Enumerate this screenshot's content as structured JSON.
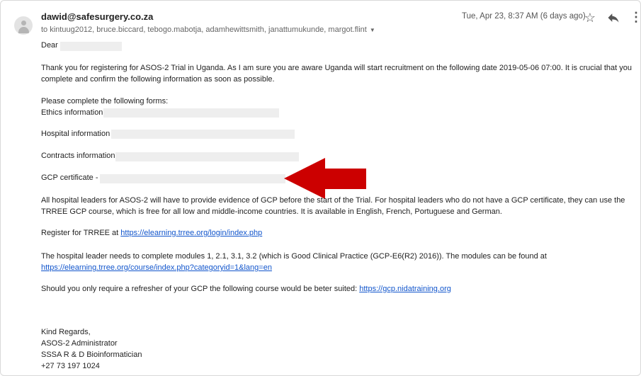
{
  "header": {
    "sender": "dawid@safesurgery.co.za",
    "recipients": "to kintuug2012, bruce.biccard, tebogo.mabotja, adamhewittsmith, janattumukunde, margot.flint",
    "date": "Tue, Apr 23, 8:37 AM (6 days ago)"
  },
  "body": {
    "greeting": "Dear",
    "para1": "Thank you for registering for ASOS-2 Trial in Uganda. As I am sure you are aware Uganda will start recruitment on the following date 2019-05-06 07:00. It is crucial that you complete and confirm the following information as soon as possible.",
    "forms_intro": "Please complete the following forms:",
    "forms": {
      "ethics": "Ethics information",
      "hospital": "Hospital information",
      "contracts": "Contracts information",
      "gcp": "GCP certificate -"
    },
    "para_gcp": "All hospital leaders for ASOS-2 will have to provide evidence of GCP before the start of the Trial. For hospital leaders who do not have a GCP certificate, they can use the TRREE GCP course, which is free for all low and middle-income countries. It is available in English, French, Portuguese and German.",
    "register_prefix": "Register for TRREE at ",
    "register_link": "https://elearning.trree.org/login/index.php",
    "modules_prefix": "The hospital leader needs to complete modules 1, 2.1, 3.1, 3.2 (which is Good Clinical Practice (GCP-E6(R2) 2016)). The modules can be found at ",
    "modules_link": "https://elearning.trree.org/course/index.php?categoryid=1&lang=en",
    "refresher_prefix": "Should you only require a refresher of your GCP the following course would be beter suited: ",
    "refresher_link": "https://gcp.nidatraining.org",
    "signature": {
      "closing": "Kind Regards,",
      "name": "ASOS-2 Administrator",
      "title": "SSSA R & D Bioinformatician",
      "phone": "+27 73 197 1024"
    }
  },
  "icons": {
    "avatar": "person-icon",
    "star": "star-icon",
    "reply": "reply-icon",
    "more": "more-vert-icon",
    "recipients_toggle": "caret-down-icon"
  },
  "colors": {
    "link": "#1155cc",
    "arrow": "#cc0000",
    "redaction": "#eeeeee"
  }
}
